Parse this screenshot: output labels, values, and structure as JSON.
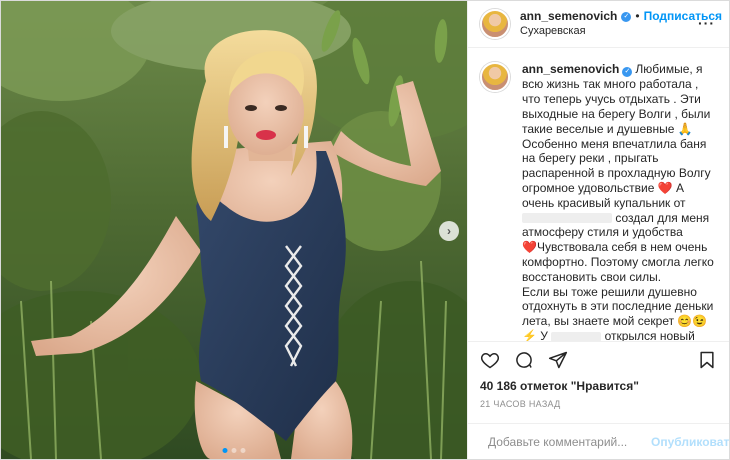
{
  "post": {
    "username": "ann_semenovich",
    "follow_separator": "•",
    "follow_label": "Подписаться",
    "location": "Сухаревская",
    "more_label": "···"
  },
  "caption": {
    "line1": "Любимые, я всю жизнь так много работала , что теперь учусь отдыхать . Эти выходные на берегу Волги , были такие веселые и душевные 🙏\nОсобенно меня впечатлила баня на берегу реки , прыгать распаренной в прохладную Волгу огромное удовольствие ",
    "heart1": "❤️",
    "line2": " А очень красивый купальник от ",
    "line3": " создал для меня атмосферу стиля и удобства\n",
    "heart2": "❤️",
    "line4": "Чувствовала себя в нем очень комфортно. Поэтому смогла легко восстановить свои силы.\nЕсли вы тоже решили душевно отдохнуть в эти последние деньки лета, вы знаете мой секрет 😊😉\n",
    "bolt": "⚡",
    "line5": " У ",
    "line6": " открылся новый магазин в Москве в ТЦ «Райкин"
  },
  "stats": {
    "likes": "40 186 отметок \"Нравится\"",
    "time": "21 ЧАСОВ НАЗАД"
  },
  "comment_box": {
    "placeholder": "Добавьте комментарий...",
    "publish_label": "Опубликовать"
  },
  "carousel": {
    "next_label": "›",
    "slides": 3,
    "active_index": 0
  },
  "colors": {
    "accent": "#0095f6",
    "verified": "#3897f0",
    "swimsuit": "#2c3e5c"
  },
  "icons": [
    "heart-icon",
    "comment-icon",
    "share-icon",
    "save-icon",
    "smile-icon",
    "verified-badge-icon",
    "more-options-icon"
  ]
}
